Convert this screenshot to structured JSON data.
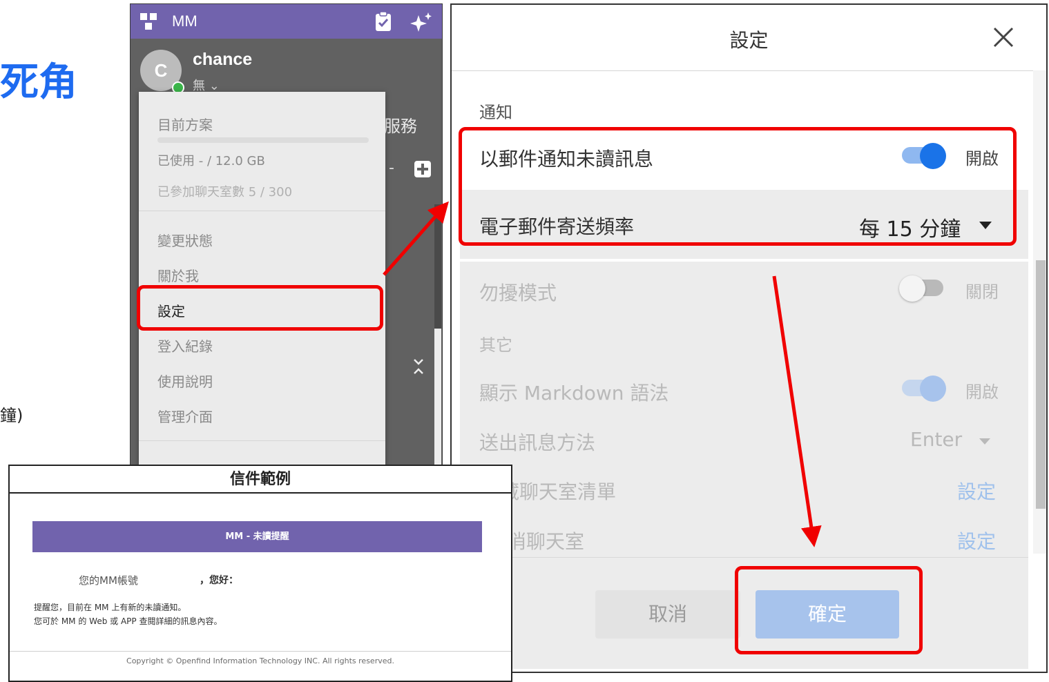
{
  "background": {
    "heading_fragment": "死角",
    "text_fragment": "鐘)"
  },
  "app": {
    "name": "MM",
    "user": {
      "initial": "C",
      "name": "chance",
      "status": "無"
    },
    "tab_label": "服務",
    "dash": "-",
    "icons": [
      "grid-logo-icon",
      "clipboard-check-icon",
      "sparkle-icon",
      "add-chat-icon",
      "chevron-collapse-icon"
    ],
    "accent_color": "#7163ad"
  },
  "menu": {
    "plan_label": "目前方案",
    "storage_used": "已使用 - / 12.0 GB",
    "rooms_joined": "已參加聊天室數 5 / 300",
    "items": [
      "變更狀態",
      "關於我",
      "設定",
      "登入紀錄",
      "使用說明",
      "管理介面"
    ],
    "selected": "設定"
  },
  "settings": {
    "title": "設定",
    "notify_section": "通知",
    "email_unread": {
      "label": "以郵件通知未讀訊息",
      "state": "開啟",
      "on": true
    },
    "email_freq": {
      "label": "電子郵件寄送頻率",
      "value": "每 15 分鐘"
    },
    "dnd": {
      "label": "勿擾模式",
      "state": "關閉",
      "on": false
    },
    "other_section": "其它",
    "markdown": {
      "label": "顯示 Markdown 語法",
      "state": "開啟",
      "on": true
    },
    "send_method": {
      "label": "送出訊息方法",
      "value": "Enter"
    },
    "room_list": {
      "label": "藏聊天室清單",
      "action": "設定"
    },
    "mute_room": {
      "label": "消聊天室",
      "action": "設定"
    },
    "cancel_label": "取消",
    "confirm_label": "確定",
    "toggle_on_color": "#1a73e8",
    "highlight_color": "#f00000"
  },
  "email_example": {
    "caption": "信件範例",
    "banner": "MM - 未讀提醒",
    "account_label": "您的MM帳號",
    "greeting": "，您好：",
    "line1": "提醒您，目前在 MM 上有新的未讀通知。",
    "line2": "您可於 MM 的 Web 或 APP 查閱詳細的訊息內容。",
    "copyright": "Copyright © Openfind Information Technology INC. All rights reserved."
  }
}
